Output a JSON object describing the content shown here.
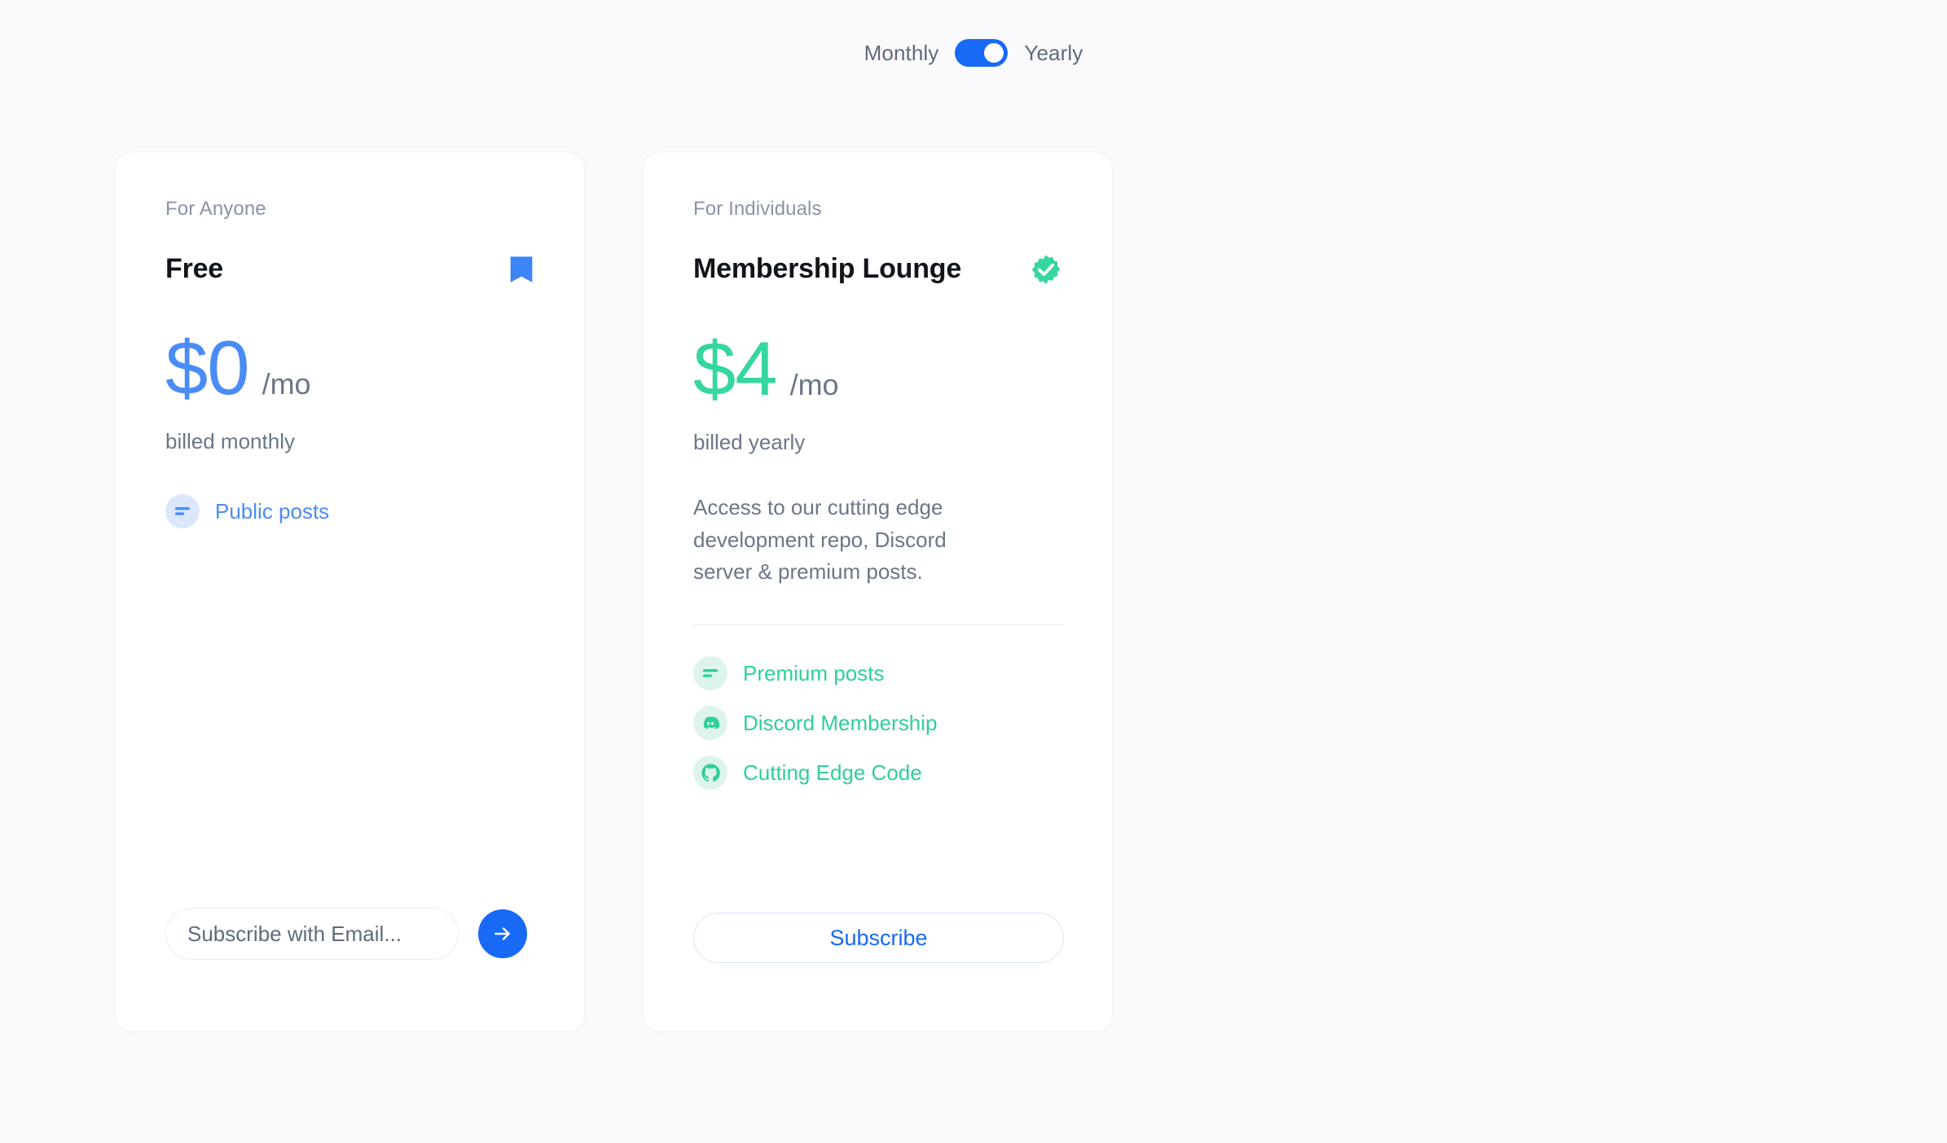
{
  "billing": {
    "monthly_label": "Monthly",
    "yearly_label": "Yearly",
    "active": "Yearly",
    "toggle_on": true,
    "accent_color": "#1769f6"
  },
  "plans": [
    {
      "eyebrow": "For Anyone",
      "title": "Free",
      "badge_icon": "bookmark-icon",
      "badge_color": "#3d84f7",
      "price_amount": "$0",
      "price_color": "#4a8cf7",
      "price_period": "/mo",
      "billed_note": "billed monthly",
      "features": [
        {
          "label": "Public posts",
          "icon": "posts-icon",
          "color": "#4a8cf7"
        }
      ],
      "email_placeholder": "Subscribe with Email...",
      "email_value": "",
      "submit_icon": "arrow-right-icon"
    },
    {
      "eyebrow": "For Individuals",
      "title": "Membership Lounge",
      "badge_icon": "verified-badge-icon",
      "badge_color": "#36d6a0",
      "price_amount": "$4",
      "price_color": "#36d6a0",
      "price_period": "/mo",
      "billed_note": "billed yearly",
      "description": "Access to our cutting edge development repo, Discord server & premium posts.",
      "features": [
        {
          "label": "Premium posts",
          "icon": "posts-icon",
          "color": "#2fcf96"
        },
        {
          "label": "Discord Membership",
          "icon": "discord-icon",
          "color": "#2fcf96"
        },
        {
          "label": "Cutting Edge Code",
          "icon": "github-icon",
          "color": "#2fcf96"
        }
      ],
      "subscribe_label": "Subscribe"
    }
  ]
}
